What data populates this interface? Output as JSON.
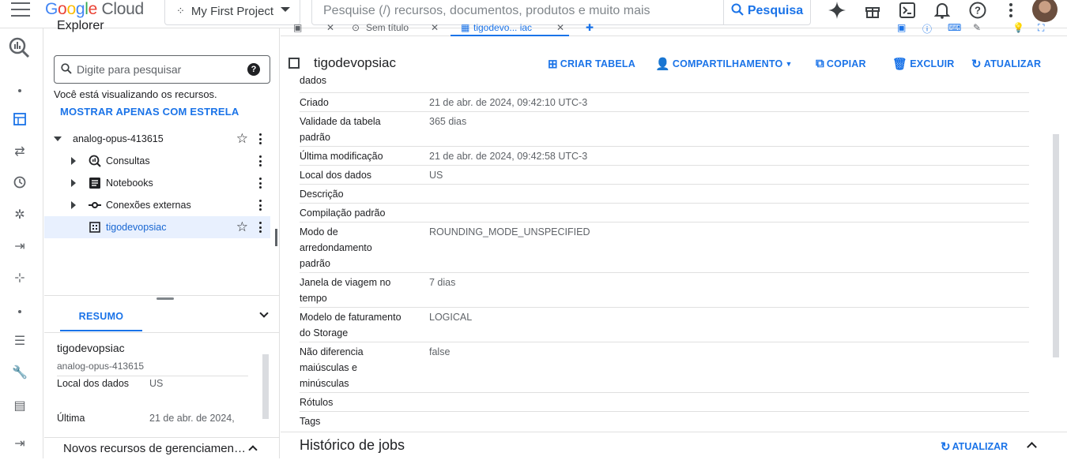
{
  "header": {
    "logo_google": "Google",
    "logo_cloud": "Cloud",
    "project": "My First Project",
    "search_placeholder": "Pesquise (/) recursos, documentos, produtos e muito mais",
    "search_button": "Pesquisa"
  },
  "explorer": {
    "title": "Explorer",
    "search_placeholder": "Digite para pesquisar",
    "note": "Você está visualizando os recursos.",
    "starred_link": "MOSTRAR APENAS COM ESTRELA",
    "tree": [
      {
        "label": "analog-opus-413615"
      },
      {
        "label": "Consultas"
      },
      {
        "label": "Notebooks"
      },
      {
        "label": "Conexões externas"
      },
      {
        "label": "tigodevopsiac"
      }
    ]
  },
  "summary": {
    "tab": "RESUMO",
    "title": "tigodevopsiac",
    "subtitle": "analog-opus-413615",
    "rows": [
      {
        "label": "Local dos dados",
        "value": "US"
      },
      {
        "label": "Última modificação",
        "value": "21 de abr. de 2024,"
      }
    ],
    "footer": "Novos recursos de gerenciamen…"
  },
  "tabs": {
    "tab1": "Sem título",
    "tab2": "tigodevo... iac"
  },
  "resource": {
    "title": "tigodevopsiac",
    "actions": {
      "create_table": "CRIAR TABELA",
      "share": "COMPARTILHAMENTO",
      "copy": "COPIAR",
      "delete": "EXCLUIR",
      "refresh": "ATUALIZAR"
    }
  },
  "details": [
    {
      "label": "dados",
      "value": ""
    },
    {
      "label": "Criado",
      "value": "21 de abr. de 2024, 09:42:10 UTC-3"
    },
    {
      "label": "Validade da tabela padrão",
      "value": "365 dias"
    },
    {
      "label": "Última modificação",
      "value": "21 de abr. de 2024, 09:42:58 UTC-3"
    },
    {
      "label": "Local dos dados",
      "value": "US"
    },
    {
      "label": "Descrição",
      "value": ""
    },
    {
      "label": "Compilação padrão",
      "value": ""
    },
    {
      "label": "Modo de arredondamento padrão",
      "value": "ROUNDING_MODE_UNSPECIFIED"
    },
    {
      "label": "Janela de viagem no tempo",
      "value": "7 dias"
    },
    {
      "label": "Modelo de faturamento do Storage",
      "value": "LOGICAL"
    },
    {
      "label": "Não diferencia maiúsculas e minúsculas",
      "value": "false"
    },
    {
      "label": "Rótulos",
      "value": ""
    },
    {
      "label": "Tags",
      "value": ""
    }
  ],
  "jobs": {
    "title": "Histórico de jobs",
    "refresh": "ATUALIZAR"
  }
}
